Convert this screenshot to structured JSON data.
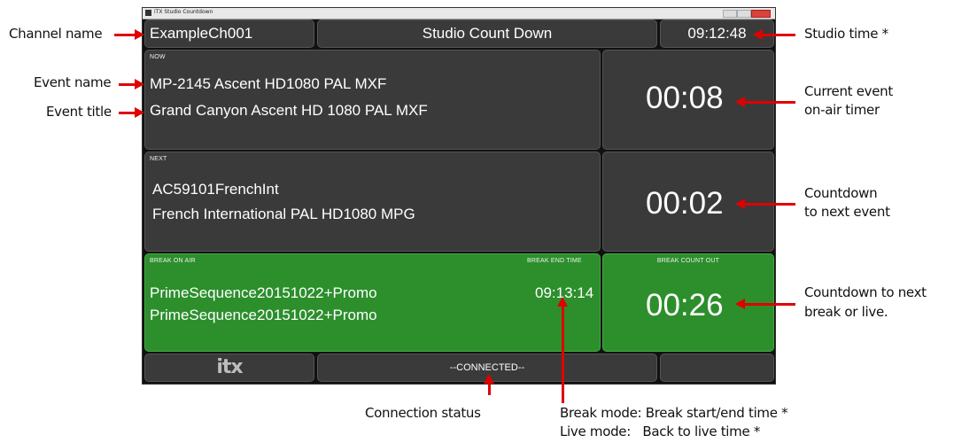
{
  "window": {
    "title": "iTX Studio Countdown",
    "channel_name": "ExampleCh001",
    "header_title": "Studio Count Down",
    "studio_time": "09:12:48"
  },
  "now": {
    "label": "NOW",
    "event_name": "MP-2145 Ascent HD1080 PAL MXF",
    "event_title": "Grand Canyon Ascent HD 1080 PAL MXF",
    "timer": "00:08"
  },
  "next": {
    "label": "NEXT",
    "event_name": "AC59101FrenchInt",
    "event_title": "French International PAL HD1080 MPG",
    "timer": "00:02"
  },
  "break": {
    "label": "BREAK ON AIR",
    "end_time_label": "BREAK END TIME",
    "event_name": "PrimeSequence20151022+Promo",
    "event_title": "PrimeSequence20151022+Promo",
    "end_time": "09:13:14",
    "count_out_label": "BREAK COUNT OUT",
    "timer": "00:26",
    "color": "#2c8f2c"
  },
  "footer": {
    "logo": "itx",
    "connection_status": "--CONNECTED--"
  },
  "annotations": {
    "channel_name": "Channel name",
    "studio_time": "Studio time *",
    "event_name": "Event name",
    "event_title": "Event title",
    "current_timer_1": "Current event",
    "current_timer_2": "on-air timer",
    "countdown_next_1": "Countdown",
    "countdown_next_2": "to next event",
    "countdown_break_1": "Countdown to next",
    "countdown_break_2": "break or live.",
    "connection_status": "Connection status",
    "break_mode": "Break mode: Break start/end time *",
    "live_mode": "Live mode:   Back to live time *",
    "arrow_color": "#e00000"
  }
}
